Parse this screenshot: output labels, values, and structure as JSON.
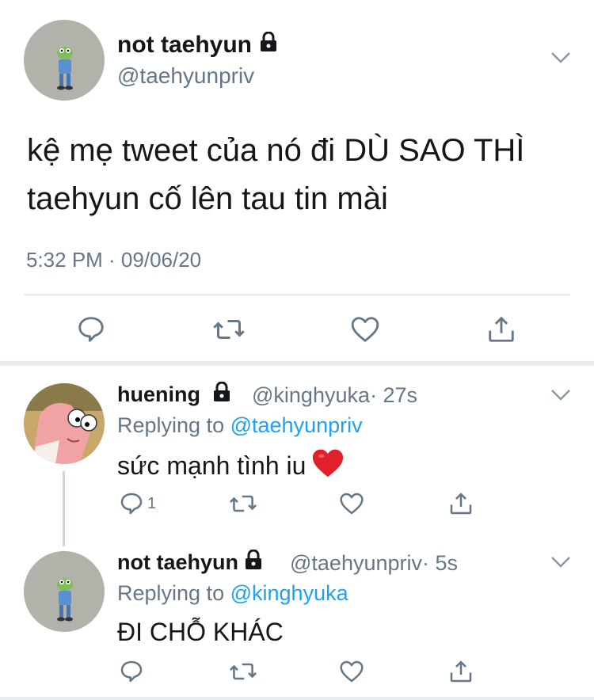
{
  "main_tweet": {
    "display_name": "not taehyun",
    "handle": "@taehyunpriv",
    "text": "kệ mẹ tweet của nó đi DÙ SAO THÌ taehyun cố lên tau tin mài",
    "timestamp": "5:32 PM · 09/06/20"
  },
  "replies": [
    {
      "display_name": "huening",
      "handle": "@kinghyuka",
      "time": "· 27s",
      "replying_prefix": "Replying to",
      "replying_to": "@taehyunpriv",
      "text": "sức mạnh tình iu",
      "reply_count": "1"
    },
    {
      "display_name": "not taehyun",
      "handle": "@taehyunpriv",
      "time": "· 5s",
      "replying_prefix": "Replying to",
      "replying_to": "@kinghyuka",
      "text": "ĐI CHỖ KHÁC"
    }
  ],
  "icons": {
    "lock": "lock-icon",
    "more": "chevron-down-icon",
    "reply": "reply-icon",
    "retweet": "retweet-icon",
    "like": "heart-icon",
    "share": "share-icon",
    "emoji": "red-heart-emoji"
  },
  "colors": {
    "text": "#14171a",
    "secondary": "#657786",
    "link": "#1da1f2",
    "divider": "#e6ecf0",
    "emoji_heart": "#e0202a"
  }
}
